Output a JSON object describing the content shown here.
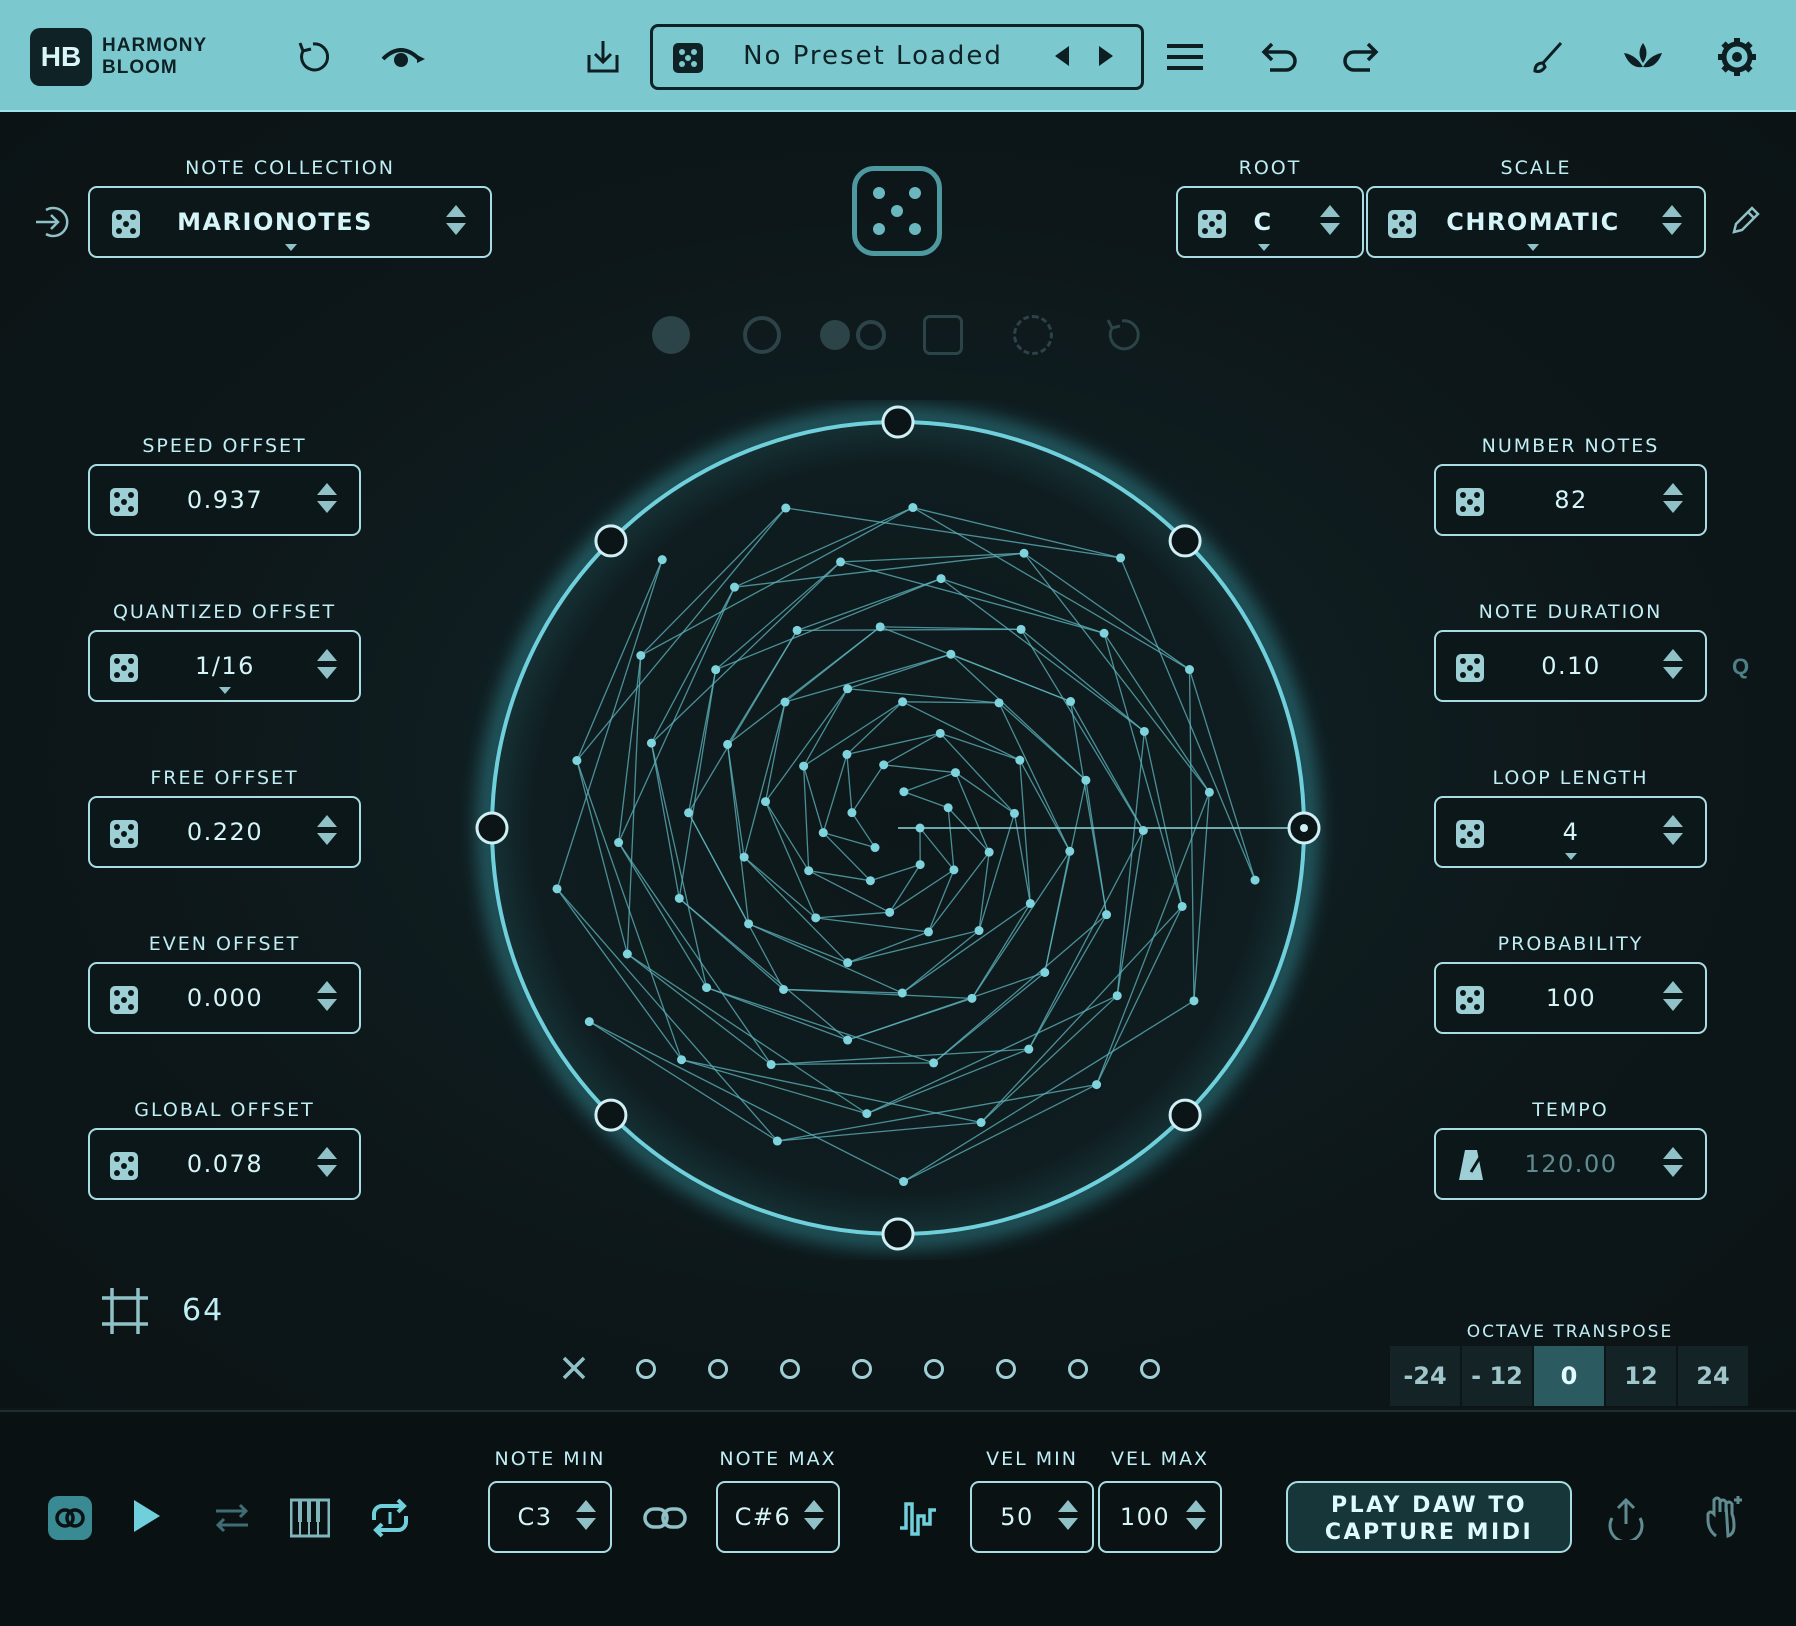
{
  "app": {
    "logo": "HB",
    "name_line1": "HARMONY",
    "name_line2": "BLOOM"
  },
  "toolbar": {
    "preset_name": "No Preset Loaded",
    "icons": [
      "reset-icon",
      "eye-icon",
      "save-icon",
      "dice-icon",
      "prev-icon",
      "next-icon",
      "menu-icon",
      "undo-icon",
      "redo-icon",
      "brush-icon",
      "lotus-icon",
      "gear-icon"
    ]
  },
  "left_params": {
    "note_collection": {
      "label": "NOTE COLLECTION",
      "value": "MARIONOTES"
    },
    "speed_offset": {
      "label": "SPEED OFFSET",
      "value": "0.937"
    },
    "quantized_offset": {
      "label": "QUANTIZED OFFSET",
      "value": "1/16"
    },
    "free_offset": {
      "label": "FREE OFFSET",
      "value": "0.220"
    },
    "even_offset": {
      "label": "EVEN OFFSET",
      "value": "0.000"
    },
    "global_offset": {
      "label": "GLOBAL OFFSET",
      "value": "0.078"
    },
    "grid_value": "64"
  },
  "right_params": {
    "root": {
      "label": "ROOT",
      "value": "C"
    },
    "scale": {
      "label": "SCALE",
      "value": "CHROMATIC"
    },
    "number_notes": {
      "label": "NUMBER NOTES",
      "value": "82"
    },
    "note_duration": {
      "label": "NOTE DURATION",
      "value": "0.10",
      "q": "Q"
    },
    "loop_length": {
      "label": "LOOP LENGTH",
      "value": "4"
    },
    "probability": {
      "label": "PROBABILITY",
      "value": "100"
    },
    "tempo": {
      "label": "TEMPO",
      "value": "120.00"
    }
  },
  "octave": {
    "label": "OCTAVE TRANSPOSE",
    "options": [
      "-24",
      "- 12",
      "0",
      "12",
      "24"
    ],
    "selected": "0"
  },
  "bottom": {
    "note_min": {
      "label": "NOTE MIN",
      "value": "C3"
    },
    "note_max": {
      "label": "NOTE MAX",
      "value": "C#6"
    },
    "vel_min": {
      "label": "VEL MIN",
      "value": "50"
    },
    "vel_max": {
      "label": "VEL MAX",
      "value": "100"
    },
    "capture_line1": "PLAY DAW TO",
    "capture_line2": "CAPTURE MIDI"
  },
  "colors": {
    "accent": "#7bc9cf",
    "ring": "#5fd0dc",
    "dot": "#7fd3dc",
    "background": "#0e1618"
  }
}
